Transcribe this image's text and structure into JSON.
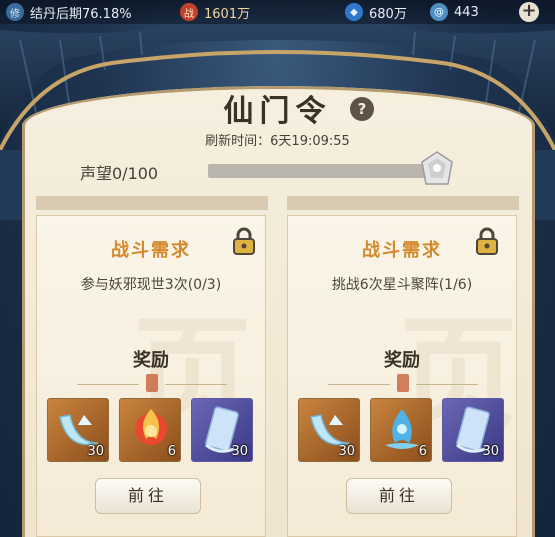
{
  "topbar": {
    "realm": "结丹后期76.18%",
    "power": "1601万",
    "power_badge": "战",
    "spirit_stones": "680万",
    "currency": "443",
    "add_icon": "plus-icon"
  },
  "header": {
    "title": "仙门令",
    "help_icon": "question-icon",
    "refresh_text": "刷新时间：6天19:09:55"
  },
  "reputation": {
    "label": "声望0/100",
    "progress": 0
  },
  "cards": [
    {
      "title": "战斗需求",
      "description": "参与妖邪现世3次(0/3)",
      "reward_title": "奖励",
      "items": [
        {
          "icon": "crescent-blade-icon",
          "count": "30"
        },
        {
          "icon": "fire-orb-icon",
          "count": "6"
        },
        {
          "icon": "talisman-scroll-icon",
          "count": "30"
        }
      ],
      "button": "前往"
    },
    {
      "title": "战斗需求",
      "description": "挑战6次星斗聚阵(1/6)",
      "reward_title": "奖励",
      "items": [
        {
          "icon": "crescent-blade-icon",
          "count": "30"
        },
        {
          "icon": "water-flame-icon",
          "count": "6"
        },
        {
          "icon": "talisman-scroll-icon",
          "count": "30"
        }
      ],
      "button": "前往"
    }
  ],
  "colors": {
    "accent": "#d48a2c",
    "parchment": "#f6efdf",
    "dark_text": "#3b3226"
  }
}
